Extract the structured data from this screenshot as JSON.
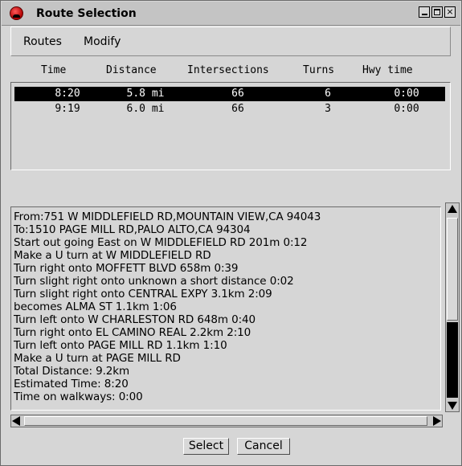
{
  "window": {
    "title": "Route Selection",
    "controls": {
      "minimize": "_",
      "maximize": "□",
      "close": "×"
    }
  },
  "menu": {
    "items": [
      {
        "label": "Routes"
      },
      {
        "label": "Modify"
      }
    ]
  },
  "routes": {
    "columns": [
      "Time",
      "Distance",
      "Intersections",
      "Turns",
      "Hwy time"
    ],
    "rows": [
      {
        "time": "8:20",
        "distance": "5.8 mi",
        "intersections": "66",
        "turns": "6",
        "hwy_time": "0:00",
        "selected": true
      },
      {
        "time": "9:19",
        "distance": "6.0 mi",
        "intersections": "66",
        "turns": "3",
        "hwy_time": "0:00",
        "selected": false
      }
    ]
  },
  "directions": {
    "lines": [
      "From:751 W MIDDLEFIELD RD,MOUNTAIN VIEW,CA 94043",
      "To:1510 PAGE MILL RD,PALO ALTO,CA 94304",
      "Start out going East on W MIDDLEFIELD RD 201m 0:12",
      "Make a U turn at W MIDDLEFIELD RD",
      "Turn right onto MOFFETT BLVD 658m 0:39",
      "Turn slight right onto unknown a short distance 0:02",
      "Turn slight right onto CENTRAL EXPY 3.1km 2:09",
      "becomes ALMA ST 1.1km 1:06",
      "Turn left onto W CHARLESTON RD 648m 0:40",
      "Turn right onto EL CAMINO REAL 2.2km 2:10",
      "Turn left onto PAGE MILL RD 1.1km 1:10",
      "Make a U turn at PAGE MILL RD",
      "Total Distance: 9.2km",
      "Estimated Time: 8:20",
      "Time on walkways: 0:00"
    ]
  },
  "buttons": {
    "select": "Select",
    "cancel": "Cancel"
  },
  "colors": {
    "background": "#d6d6d6",
    "selection": "#000000",
    "selection_text": "#ffffff"
  }
}
